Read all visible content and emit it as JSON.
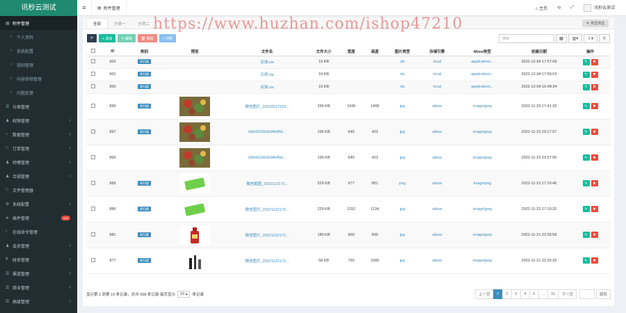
{
  "app": {
    "title": "讯秒云测试"
  },
  "sidebar": {
    "items": [
      {
        "label": "附件管理",
        "active": true,
        "chev": false,
        "sub": false,
        "icon": "table-icon",
        "glyph": "▦"
      },
      {
        "label": "个人资料",
        "sub": true,
        "icon": "circle-icon",
        "glyph": "○"
      },
      {
        "label": "系统配置",
        "sub": true,
        "icon": "circle-icon",
        "glyph": "○"
      },
      {
        "label": "规则管理",
        "sub": true,
        "icon": "circle-icon",
        "glyph": "○"
      },
      {
        "label": "内容审核管理",
        "sub": true,
        "icon": "circle-icon",
        "glyph": "○"
      },
      {
        "label": "问题反馈",
        "sub": true,
        "icon": "circle-icon",
        "glyph": "○"
      },
      {
        "label": "分类管理",
        "chev": false,
        "icon": "list-icon",
        "glyph": "☰"
      },
      {
        "label": "权限管理",
        "chev": true,
        "icon": "users-icon",
        "glyph": "♟"
      },
      {
        "label": "数据管理",
        "chev": true,
        "icon": "circle-icon",
        "glyph": "○"
      },
      {
        "label": "订单管理",
        "chev": true,
        "icon": "file-icon",
        "glyph": "□"
      },
      {
        "label": "师傅管理",
        "chev": true,
        "icon": "user-icon",
        "glyph": "♟"
      },
      {
        "label": "合规管理",
        "chev": true,
        "icon": "user-icon",
        "glyph": "♟"
      },
      {
        "label": "文件管理器",
        "chev": false,
        "icon": "folder-icon",
        "glyph": "□"
      },
      {
        "label": "系统配置",
        "chev": true,
        "icon": "gear-icon",
        "glyph": "⚙"
      },
      {
        "label": "插件管理",
        "chev": false,
        "icon": "send-icon",
        "glyph": "➤",
        "badge": "new"
      },
      {
        "label": "在线命令管理",
        "chev": false,
        "icon": "terminal-icon",
        "glyph": "›"
      },
      {
        "label": "会员管理",
        "chev": true,
        "icon": "user-icon",
        "glyph": "♟"
      },
      {
        "label": "财务管理",
        "chev": true,
        "icon": "money-icon",
        "glyph": "¥"
      },
      {
        "label": "渠道管理",
        "chev": true,
        "icon": "list-icon",
        "glyph": "☰"
      },
      {
        "label": "商业管理",
        "chev": true,
        "icon": "list-icon",
        "glyph": "☰"
      },
      {
        "label": "高级管理",
        "chev": true,
        "icon": "list-icon",
        "glyph": "☰"
      }
    ]
  },
  "topbar": {
    "tab_label": "附件管理",
    "home": "主页",
    "user": "讯秒云测试"
  },
  "subtabs": [
    {
      "label": "全部",
      "active": true
    },
    {
      "label": "分类一"
    },
    {
      "label": "分类二"
    }
  ],
  "type_filter": "类型筛选",
  "toolbar": {
    "add": "+ 添加",
    "edit": "✎ 编辑",
    "delete": "🗑 删除",
    "classify": "+ 归类",
    "search_placeholder": "搜索"
  },
  "table": {
    "headers": [
      "",
      "ID",
      "类别",
      "预览",
      "文件名",
      "文件大小",
      "宽度",
      "高度",
      "图片类型",
      "存储引擎",
      "Mime类型",
      "创建日期",
      "操作"
    ],
    "rows": [
      {
        "id": "902",
        "cat": "未归类",
        "preview": "",
        "name": "足球.xls",
        "size": "19 KB",
        "w": "",
        "h": "",
        "type": "xls",
        "storage": "local",
        "mime": "application/...",
        "date": "2022-12-04 17:57:09",
        "big": false
      },
      {
        "id": "901",
        "cat": "未归类",
        "preview": "",
        "name": "示例.xls",
        "size": "19 KB",
        "w": "",
        "h": "",
        "type": "xls",
        "storage": "local",
        "mime": "application/...",
        "date": "2022-12-04 17:55:03",
        "big": false
      },
      {
        "id": "900",
        "cat": "未归类",
        "preview": "",
        "name": "足球.xls",
        "size": "19 KB",
        "w": "",
        "h": "",
        "type": "xls",
        "storage": "local",
        "mime": "application/...",
        "date": "2022-12-04 16:48:34",
        "big": false
      },
      {
        "id": "899",
        "cat": "未归类",
        "preview": "painting",
        "name": "微信图片_20220517223...",
        "size": "296 KB",
        "w": "1436",
        "h": "1408",
        "type": "jpg",
        "storage": "alioss",
        "mime": "image/jpeg",
        "date": "2022-11-29 17:41:33",
        "big": true
      },
      {
        "id": "897",
        "cat": "未归类",
        "preview": "painting",
        "name": "b3b43166d2d4b45d...",
        "size": "196 KB",
        "w": "640",
        "h": "423",
        "type": "jpg",
        "storage": "alioss",
        "mime": "image/jpeg",
        "date": "2022-11-23 19:17:57",
        "big": true
      },
      {
        "id": "893",
        "cat": "",
        "preview": "painting",
        "name": "b3b43166d2d4b45d...",
        "size": "196 KB",
        "w": "640",
        "h": "423",
        "type": "jpg",
        "storage": "alioss",
        "mime": "image/jpeg",
        "date": "2022-11-22 23:27:05",
        "big": true
      },
      {
        "id": "889",
        "cat": "未归类",
        "preview": "card",
        "name": "微信截图_2022112172...",
        "size": "529 KB",
        "w": "977",
        "h": "851",
        "type": "png",
        "storage": "alioss",
        "mime": "image/png",
        "date": "2022-11-22 17:10:46",
        "big": true
      },
      {
        "id": "886",
        "cat": "未归类",
        "preview": "card",
        "name": "微信图片_20221122172...",
        "size": "229 KB",
        "w": "1152",
        "h": "1134",
        "type": "jpg",
        "storage": "alioss",
        "mime": "image/jpeg",
        "date": "2022-11-22 17:10:32",
        "big": true
      },
      {
        "id": "881",
        "cat": "未归类",
        "preview": "bottle",
        "name": "微信图片_20221122172...",
        "size": "180 KB",
        "w": "800",
        "h": "800",
        "type": "jpg",
        "storage": "alioss",
        "mime": "image/jpeg",
        "date": "2022-11-21 22:35:58",
        "big": true
      },
      {
        "id": "877",
        "cat": "未归类",
        "preview": "product",
        "name": "微信图片_20221122172...",
        "size": "58 KB",
        "w": "750",
        "h": "1000",
        "type": "jpg",
        "storage": "alioss",
        "mime": "image/jpeg",
        "date": "2022-11-21 22:35:33",
        "big": true
      }
    ]
  },
  "footer": {
    "showing": "显示第 1 到第 10 条记录，总共 508 条记录 每页显示",
    "page_size": "10 ▴",
    "suffix": "条记录"
  },
  "pagination": {
    "prev": "上一页",
    "pages": [
      "1",
      "2",
      "3",
      "4",
      "5",
      "...",
      "51"
    ],
    "next": "下一页",
    "jump": "跳转"
  },
  "watermark": "https://www.huzhan.com/ishop47210"
}
